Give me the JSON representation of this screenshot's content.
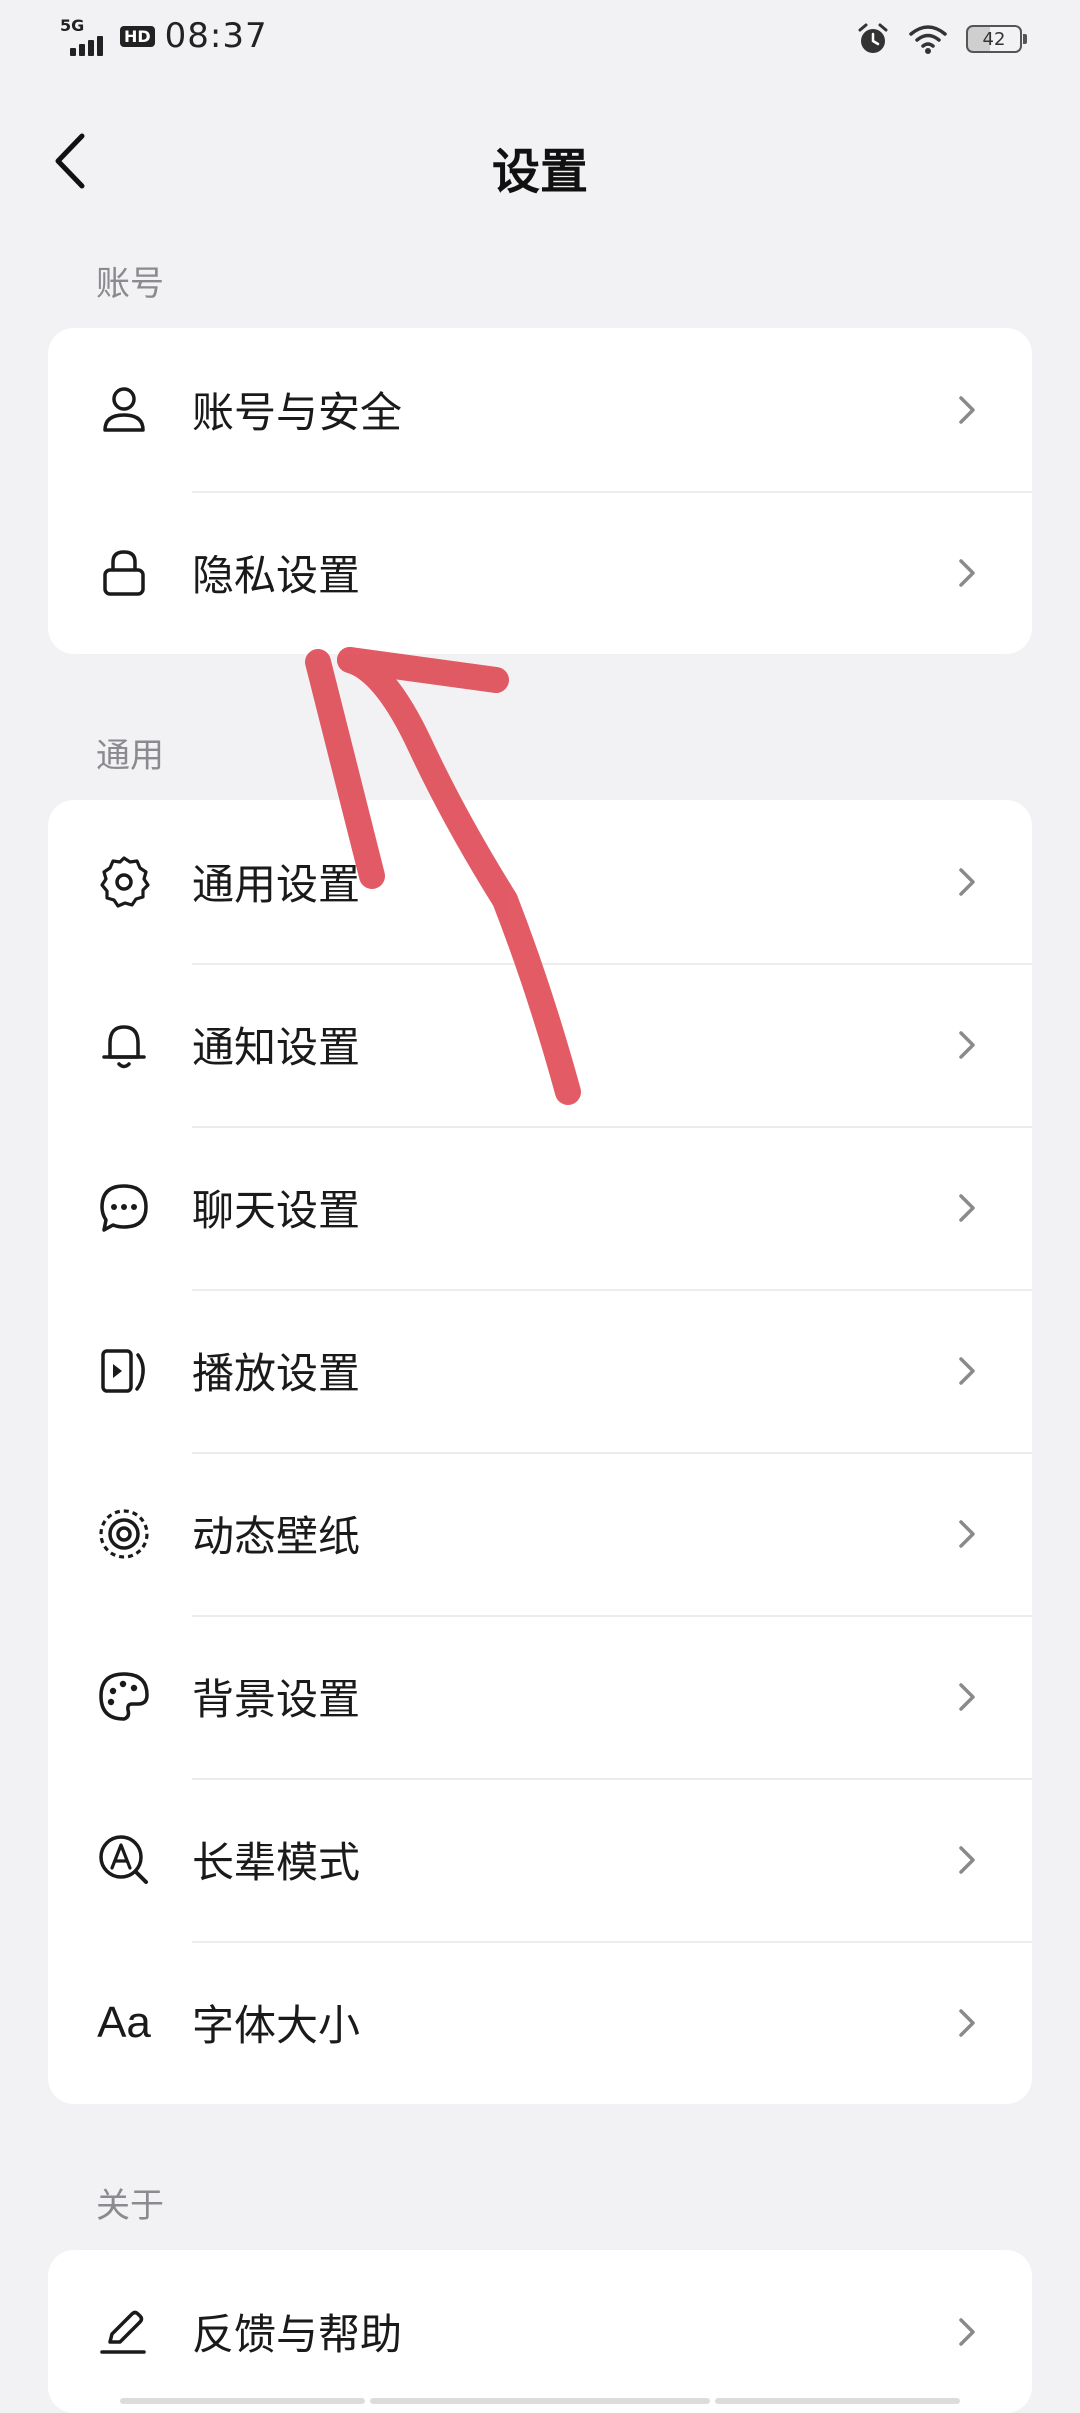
{
  "status_bar": {
    "network": "5G",
    "hd": "HD",
    "time": "08:37",
    "battery": "42"
  },
  "header": {
    "title": "设置"
  },
  "sections": [
    {
      "label": "账号",
      "items": [
        {
          "icon": "user-icon",
          "label": "账号与安全"
        },
        {
          "icon": "lock-icon",
          "label": "隐私设置"
        }
      ]
    },
    {
      "label": "通用",
      "items": [
        {
          "icon": "gear-icon",
          "label": "通用设置"
        },
        {
          "icon": "bell-icon",
          "label": "通知设置"
        },
        {
          "icon": "chat-bubble-icon",
          "label": "聊天设置"
        },
        {
          "icon": "play-screen-icon",
          "label": "播放设置"
        },
        {
          "icon": "live-wallpaper-icon",
          "label": "动态壁纸"
        },
        {
          "icon": "palette-icon",
          "label": "背景设置"
        },
        {
          "icon": "elder-mode-icon",
          "label": "长辈模式"
        },
        {
          "icon": "font-size-icon",
          "label": "字体大小",
          "glyph": "Aa"
        }
      ]
    },
    {
      "label": "关于",
      "items": [
        {
          "icon": "pen-icon",
          "label": "反馈与帮助"
        }
      ]
    }
  ],
  "colors": {
    "background": "#f2f2f4",
    "card": "#ffffff",
    "section_label": "#8a8a8f",
    "annotation_arrow": "#e0525d"
  }
}
